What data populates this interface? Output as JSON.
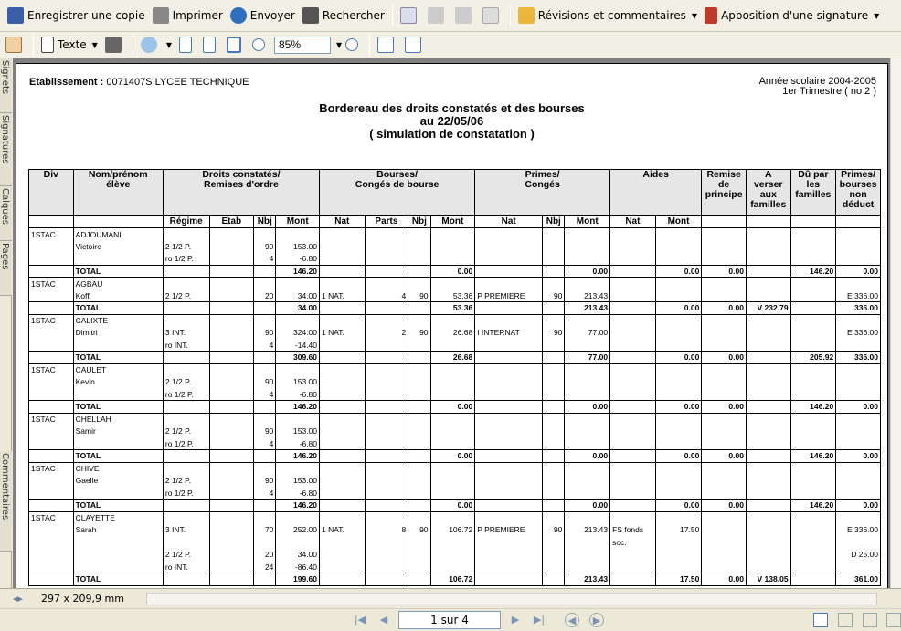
{
  "toolbar": {
    "save_label": "Enregistrer une copie",
    "print_label": "Imprimer",
    "send_label": "Envoyer",
    "search_label": "Rechercher",
    "review_label": "Révisions et commentaires",
    "sign_label": "Apposition d'une signature",
    "text_tool_label": "Texte",
    "zoom_value": "85%"
  },
  "side_tabs": [
    "Signets",
    "Signatures",
    "Calques",
    "Pages",
    "Commentaires"
  ],
  "document": {
    "etab_label": "Etablissement : ",
    "etab_value": "0071407S LYCEE TECHNIQUE",
    "year": "Année scolaire 2004-2005",
    "term": "1er Trimestre ( no 2 )",
    "title1": "Bordereau des droits constatés et des bourses",
    "title2": "au 22/05/06",
    "title3": "( simulation de constatation )"
  },
  "table": {
    "headers": {
      "div": "Div",
      "nom1": "Nom/prénom",
      "nom2": "élève",
      "droits1": "Droits constatés/",
      "droits2": "Remises d'ordre",
      "bourses1": "Bourses/",
      "bourses2": "Congés de bourse",
      "primes1": "Primes/",
      "primes2": "Congés",
      "aides": "Aides",
      "remise1": "Remise",
      "remise2": "de",
      "remise3": "principe",
      "averser1": "A",
      "averser2": "verser",
      "averser3": "aux",
      "averser4": "familles",
      "du1": "Dû par",
      "du2": "les",
      "du3": "familles",
      "pb1": "Primes/",
      "pb2": "bourses",
      "pb3": "non",
      "pb4": "déduct"
    },
    "sub": [
      "Régime",
      "Etab",
      "Nbj",
      "Mont",
      "Nat",
      "Parts",
      "Nbj",
      "Mont",
      "Nat",
      "Nbj",
      "Mont",
      "Nat",
      "Mont"
    ],
    "rows": [
      [
        "1STAC",
        "ADJOUMANI",
        "",
        "",
        "",
        "",
        "",
        "",
        "",
        "",
        "",
        "",
        "",
        "",
        "",
        "",
        "",
        "",
        "",
        ""
      ],
      [
        "",
        "Victoire",
        "2 1/2 P.",
        "",
        "90",
        "153.00",
        "",
        "",
        "",
        "",
        "",
        "",
        "",
        "",
        "",
        "",
        "",
        "",
        "",
        ""
      ],
      [
        "",
        "",
        "ro 1/2 P.",
        "",
        "4",
        "-6.80",
        "",
        "",
        "",
        "",
        "",
        "",
        "",
        "",
        "",
        "",
        "",
        "",
        "",
        ""
      ],
      [
        "",
        "TOTAL",
        "",
        "",
        "",
        "146.20",
        "",
        "",
        "",
        "0.00",
        "",
        "",
        "0.00",
        "",
        "0.00",
        "0.00",
        "",
        "146.20",
        "0.00"
      ],
      [
        "1STAC",
        "AGBAU",
        "",
        "",
        "",
        "",
        "",
        "",
        "",
        "",
        "",
        "",
        "",
        "",
        "",
        "",
        "",
        "",
        "",
        ""
      ],
      [
        "",
        "Koffi",
        "2 1/2 P.",
        "",
        "20",
        "34.00",
        "1 NAT.",
        "4",
        "90",
        "53.36",
        "P PREMIERE",
        "90",
        "213.43",
        "",
        "",
        "",
        "",
        "",
        "E 336.00"
      ],
      [
        "",
        "TOTAL",
        "",
        "",
        "",
        "34.00",
        "",
        "",
        "",
        "53.36",
        "",
        "",
        "213.43",
        "",
        "0.00",
        "0.00",
        "V 232.79",
        "",
        "336.00"
      ],
      [
        "1STAC",
        "CALIXTE",
        "",
        "",
        "",
        "",
        "",
        "",
        "",
        "",
        "",
        "",
        "",
        "",
        "",
        "",
        "",
        "",
        "",
        ""
      ],
      [
        "",
        "Dimitri",
        "3 INT.",
        "",
        "90",
        "324.00",
        "1 NAT.",
        "2",
        "90",
        "26.68",
        "I INTERNAT",
        "90",
        "77.00",
        "",
        "",
        "",
        "",
        "",
        "E 336.00"
      ],
      [
        "",
        "",
        "ro INT.",
        "",
        "4",
        "-14.40",
        "",
        "",
        "",
        "",
        "",
        "",
        "",
        "",
        "",
        "",
        "",
        "",
        "",
        ""
      ],
      [
        "",
        "TOTAL",
        "",
        "",
        "",
        "309.60",
        "",
        "",
        "",
        "26.68",
        "",
        "",
        "77.00",
        "",
        "0.00",
        "0.00",
        "",
        "205.92",
        "336.00"
      ],
      [
        "1STAC",
        "CAULET",
        "",
        "",
        "",
        "",
        "",
        "",
        "",
        "",
        "",
        "",
        "",
        "",
        "",
        "",
        "",
        "",
        "",
        ""
      ],
      [
        "",
        "Kevin",
        "2 1/2 P.",
        "",
        "90",
        "153.00",
        "",
        "",
        "",
        "",
        "",
        "",
        "",
        "",
        "",
        "",
        "",
        "",
        "",
        ""
      ],
      [
        "",
        "",
        "ro 1/2 P.",
        "",
        "4",
        "-6.80",
        "",
        "",
        "",
        "",
        "",
        "",
        "",
        "",
        "",
        "",
        "",
        "",
        "",
        ""
      ],
      [
        "",
        "TOTAL",
        "",
        "",
        "",
        "146.20",
        "",
        "",
        "",
        "0.00",
        "",
        "",
        "0.00",
        "",
        "0.00",
        "0.00",
        "",
        "146.20",
        "0.00"
      ],
      [
        "1STAC",
        "CHELLAH",
        "",
        "",
        "",
        "",
        "",
        "",
        "",
        "",
        "",
        "",
        "",
        "",
        "",
        "",
        "",
        "",
        "",
        ""
      ],
      [
        "",
        "Samir",
        "2 1/2 P.",
        "",
        "90",
        "153.00",
        "",
        "",
        "",
        "",
        "",
        "",
        "",
        "",
        "",
        "",
        "",
        "",
        "",
        ""
      ],
      [
        "",
        "",
        "ro 1/2 P.",
        "",
        "4",
        "-6.80",
        "",
        "",
        "",
        "",
        "",
        "",
        "",
        "",
        "",
        "",
        "",
        "",
        "",
        ""
      ],
      [
        "",
        "TOTAL",
        "",
        "",
        "",
        "146.20",
        "",
        "",
        "",
        "0.00",
        "",
        "",
        "0.00",
        "",
        "0.00",
        "0.00",
        "",
        "146.20",
        "0.00"
      ],
      [
        "1STAC",
        "CHIVE",
        "",
        "",
        "",
        "",
        "",
        "",
        "",
        "",
        "",
        "",
        "",
        "",
        "",
        "",
        "",
        "",
        "",
        ""
      ],
      [
        "",
        "Gaelle",
        "2 1/2 P.",
        "",
        "90",
        "153.00",
        "",
        "",
        "",
        "",
        "",
        "",
        "",
        "",
        "",
        "",
        "",
        "",
        "",
        ""
      ],
      [
        "",
        "",
        "ro 1/2 P.",
        "",
        "4",
        "-6.80",
        "",
        "",
        "",
        "",
        "",
        "",
        "",
        "",
        "",
        "",
        "",
        "",
        "",
        ""
      ],
      [
        "",
        "TOTAL",
        "",
        "",
        "",
        "146.20",
        "",
        "",
        "",
        "0.00",
        "",
        "",
        "0.00",
        "",
        "0.00",
        "0.00",
        "",
        "146.20",
        "0.00"
      ],
      [
        "1STAC",
        "CLAYETTE",
        "",
        "",
        "",
        "",
        "",
        "",
        "",
        "",
        "",
        "",
        "",
        "",
        "",
        "",
        "",
        "",
        "",
        ""
      ],
      [
        "",
        "Sarah",
        "3 INT.",
        "",
        "70",
        "252.00",
        "1 NAT.",
        "8",
        "90",
        "106.72",
        "P PREMIERE",
        "90",
        "213.43",
        "FS fonds",
        "17.50",
        "",
        "",
        "",
        "E 336.00"
      ],
      [
        "",
        "",
        "",
        "",
        "",
        "",
        "",
        "",
        "",
        "",
        "",
        "",
        "",
        "soc.",
        "",
        "",
        "",
        "",
        "",
        ""
      ],
      [
        "",
        "",
        "2 1/2 P.",
        "",
        "20",
        "34.00",
        "",
        "",
        "",
        "",
        "",
        "",
        "",
        "",
        "",
        "",
        "",
        "",
        "D 25.00"
      ],
      [
        "",
        "",
        "ro INT.",
        "",
        "24",
        "-86.40",
        "",
        "",
        "",
        "",
        "",
        "",
        "",
        "",
        "",
        "",
        "",
        "",
        "",
        ""
      ],
      [
        "",
        "TOTAL",
        "",
        "",
        "",
        "199.60",
        "",
        "",
        "",
        "106.72",
        "",
        "",
        "213.43",
        "",
        "17.50",
        "0.00",
        "V 138.05",
        "",
        "361.00"
      ]
    ]
  },
  "status": {
    "page_size": "297 x 209,9 mm"
  },
  "nav": {
    "page_display": "1 sur 4"
  }
}
